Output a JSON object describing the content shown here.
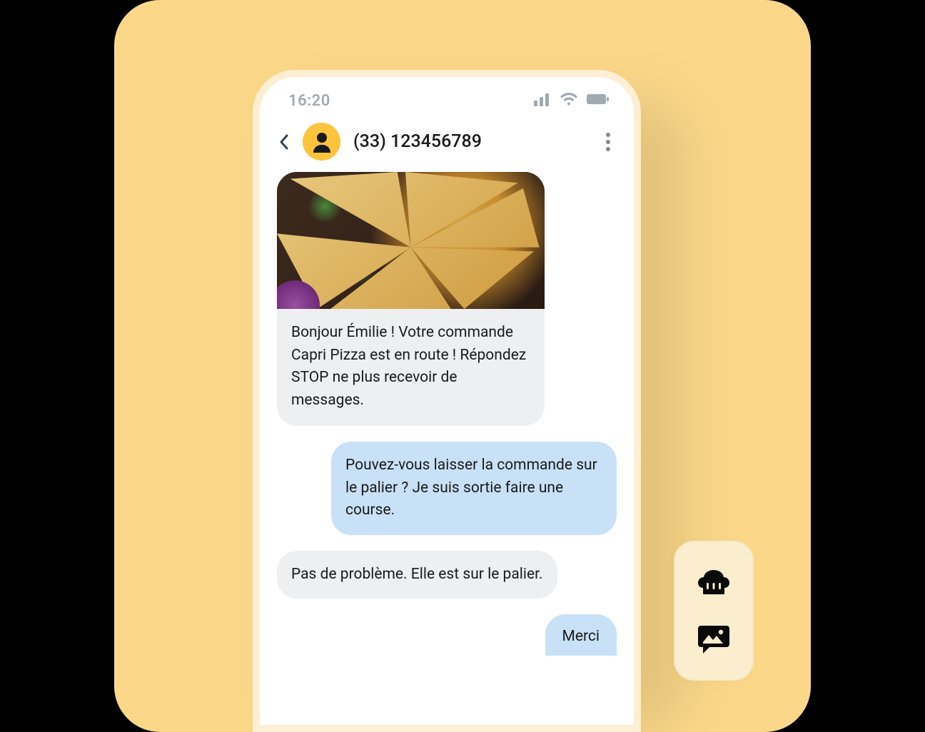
{
  "status_bar": {
    "time": "16:20"
  },
  "header": {
    "phone_number": "(33) 123456789"
  },
  "messages": {
    "m1_text": "Bonjour Émilie ! Votre commande Capri Pizza est en route ! Répondez STOP ne plus recevoir de messages.",
    "m2_text": "Pouvez-vous laisser la commande sur le palier ? Je suis sortie faire une course.",
    "m3_text": "Pas de problème. Elle est sur le palier.",
    "m4_text": "Merci"
  }
}
